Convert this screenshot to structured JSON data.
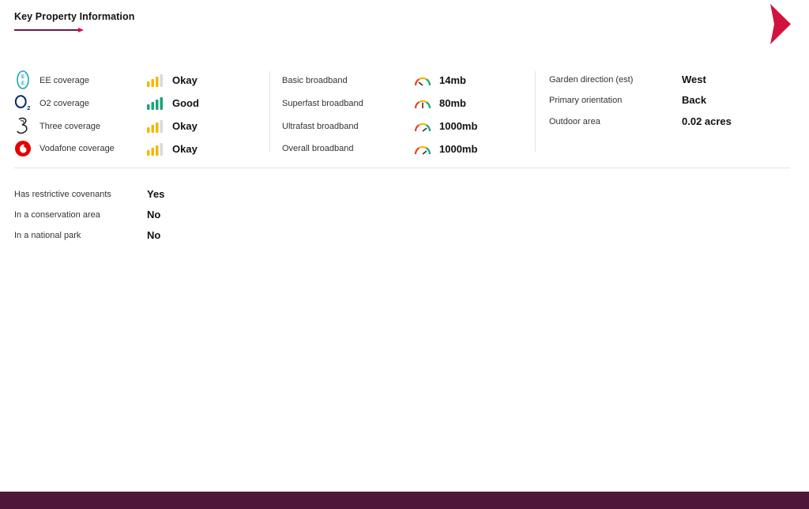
{
  "header": {
    "title": "Key Property Information"
  },
  "mobile": [
    {
      "network": "EE",
      "label": "EE coverage",
      "value": "Okay",
      "bars": 3,
      "icon": "ee-logo-icon"
    },
    {
      "network": "O2",
      "label": "O2 coverage",
      "value": "Good",
      "bars": 4,
      "icon": "o2-logo-icon"
    },
    {
      "network": "Three",
      "label": "Three coverage",
      "value": "Okay",
      "bars": 3,
      "icon": "three-logo-icon"
    },
    {
      "network": "Vodafone",
      "label": "Vodafone coverage",
      "value": "Okay",
      "bars": 3,
      "icon": "vodafone-logo-icon"
    }
  ],
  "broadband": [
    {
      "label": "Basic broadband",
      "value": "14mb",
      "gauge_level": "low"
    },
    {
      "label": "Superfast broadband",
      "value": "80mb",
      "gauge_level": "medium"
    },
    {
      "label": "Ultrafast broadband",
      "value": "1000mb",
      "gauge_level": "high"
    },
    {
      "label": "Overall broadband",
      "value": "1000mb",
      "gauge_level": "high"
    }
  ],
  "property": [
    {
      "label": "Garden direction (est)",
      "value": "West"
    },
    {
      "label": "Primary orientation",
      "value": "Back"
    },
    {
      "label": "Outdoor area",
      "value": "0.02 acres"
    }
  ],
  "legal": [
    {
      "label": "Has restrictive covenants",
      "value": "Yes"
    },
    {
      "label": "In a conservation area",
      "value": "No"
    },
    {
      "label": "In a national park",
      "value": "No"
    }
  ],
  "colors": {
    "accent": "#d1123f",
    "footer": "#4e1638",
    "signal_okay": "#f2b705",
    "signal_good": "#1aa37a",
    "signal_empty": "#d9d9d9"
  }
}
